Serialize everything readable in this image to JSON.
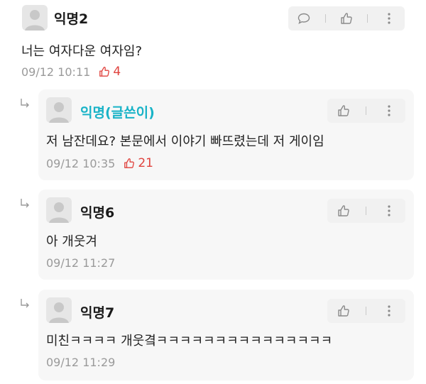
{
  "comments": [
    {
      "author": "익명2",
      "text": "너는 여자다운 여자임?",
      "time": "09/12 10:11",
      "likes": "4"
    }
  ],
  "replies": [
    {
      "author": "익명(글쓴이)",
      "text": "저 남잔데요? 본문에서 이야기 빠뜨렸는데 저 게이임",
      "time": "09/12 10:35",
      "likes": "21"
    },
    {
      "author": "익명6",
      "text": "아 개웃겨",
      "time": "09/12 11:27"
    },
    {
      "author": "익명7",
      "text": "미친ㅋㅋㅋㅋ 개웃곀ㅋㅋㅋㅋㅋㅋㅋㅋㅋㅋㅋㅋㅋㅋㅋ",
      "time": "09/12 11:29"
    }
  ],
  "colors": {
    "writer_name": "#19b3c7",
    "like_count": "#e0433e",
    "card_bg": "#f7f7f7",
    "meta_text": "#9a9a9a"
  },
  "icons": [
    "avatar-icon",
    "comment-bubble-icon",
    "thumbs-up-icon",
    "more-vertical-icon",
    "reply-arrow-icon"
  ]
}
